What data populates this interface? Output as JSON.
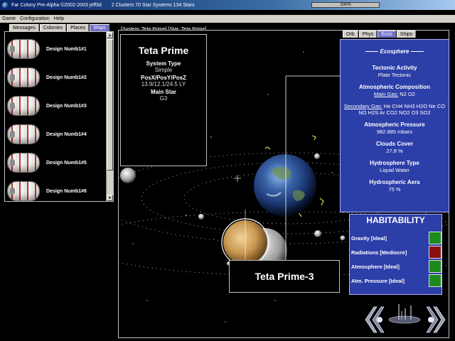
{
  "titlebar": {
    "title": "Far Colony Pre-Alpha  ©2002-2003 jeff3d",
    "stats": "2 Clusters  70 Star Systems  134 Stars",
    "progress_label": "100%",
    "progress_value": 1.0
  },
  "menu": [
    "Game",
    "Configuration",
    "Help"
  ],
  "left_tabs": [
    "Messages",
    "Colonies",
    "Places",
    "Ships"
  ],
  "left_active_tab": "Ships",
  "ships": [
    "Design Numb1#1",
    "Design Numb1#2",
    "Design Numb1#3",
    "Design Numb1#4",
    "Design Numb1#5",
    "Design Numb1#6"
  ],
  "breadcrumb": "[System: Teta Prime]  [Star: Teta Prime]",
  "system": {
    "name": "Teta Prime",
    "type_label": "System Type",
    "type_value": "Simple",
    "pos_label": "PosX/PosY/PosZ",
    "pos_value": "13.9/12.1/24.5  LY",
    "star_label": "Main Star",
    "star_value": "G3"
  },
  "planet_label": "Teta Prime-3",
  "right_tabs": [
    "Orb",
    "Phys",
    "Ecos",
    "Ships"
  ],
  "right_active_tab": "Ecos",
  "ecosphere": {
    "title": "Ecosphere",
    "tectonic_label": "Tectonic Activity",
    "tectonic_value": "Plate Tectonic",
    "atmo_label": "Atmospheric Composition",
    "main_gas_label": "Main Gas:",
    "main_gas_value": "N2 O2",
    "secondary_gas_label": "Secondary Gas:",
    "secondary_gas_value": "He CH4 NH3 H2O Ne CO NO H2S Ar CO2 NO2 O3 SO2",
    "pressure_label": "Atmospheric Pressure",
    "pressure_value": "982.885 mbars",
    "clouds_label": "Clouds Cover",
    "clouds_value": "27.8 %",
    "hydro_type_label": "Hydrosphere Type",
    "hydro_type_value": "Liquid Water",
    "hydro_area_label": "Hydrospheric Aera",
    "hydro_area_value": "75 %"
  },
  "habitability": {
    "title": "HABITABILITY",
    "rows": [
      {
        "label": "Gravity  [Ideal]",
        "color": "#1c8a1c"
      },
      {
        "label": "Radiations  [Mediocre]",
        "color": "#8a1010"
      },
      {
        "label": "Atmosphere  [Ideal]",
        "color": "#1c8a1c"
      },
      {
        "label": "Atm. Pressure  [Ideal]",
        "color": "#1c8a1c"
      }
    ]
  },
  "icons": {
    "nav_prev": "double-chevron-left-icon",
    "nav_next": "double-chevron-right-icon",
    "nav_center": "system-view-icon"
  }
}
